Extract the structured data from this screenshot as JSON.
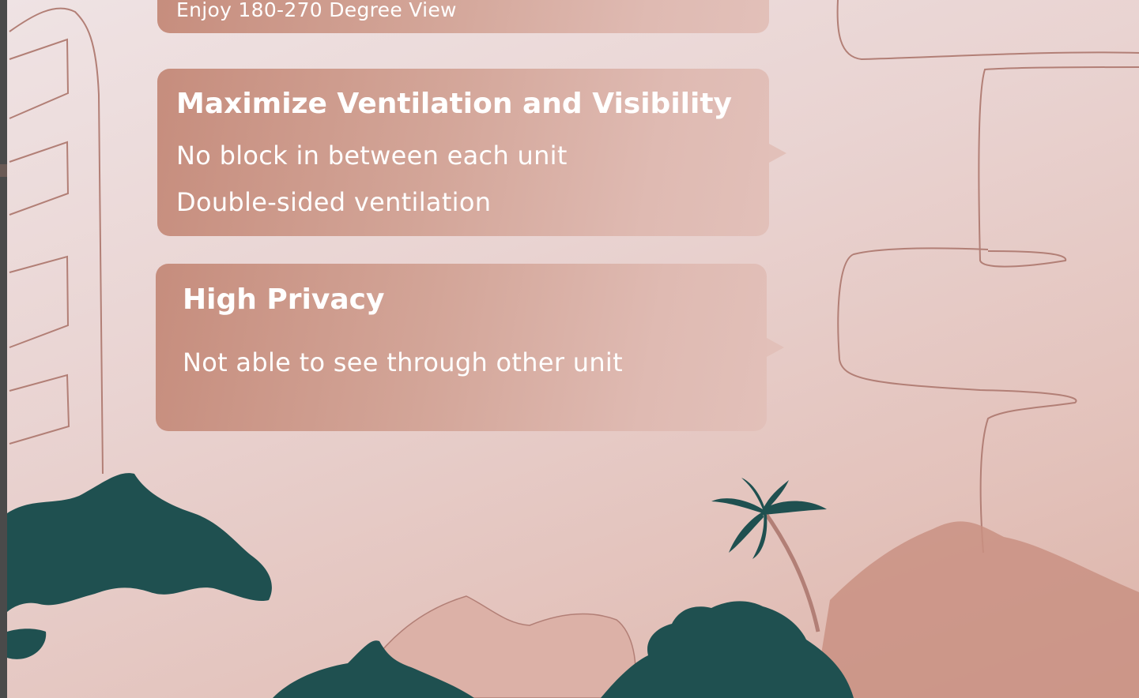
{
  "cards": {
    "previous": {
      "line": "Enjoy 180-270 Degree View"
    },
    "ventilation": {
      "title": "Maximize Ventilation and Visibility",
      "lines": [
        "No block in between each unit",
        "Double-sided ventilation"
      ]
    },
    "privacy": {
      "title": "High Privacy",
      "lines": [
        "Not able to see through other unit"
      ]
    }
  },
  "colors": {
    "card_gradient_start": "#c68d7d",
    "card_gradient_end": "#e2c0b9",
    "foliage": "#1f5050",
    "line_art": "#b27f76",
    "hills": "#c99082"
  },
  "decorations": [
    "building-outline",
    "road-outline",
    "palm-tree",
    "bush-silhouettes",
    "hill-silhouettes"
  ]
}
